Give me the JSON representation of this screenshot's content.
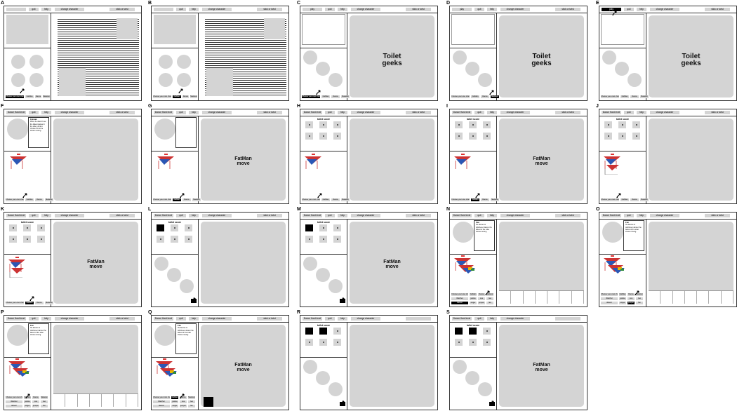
{
  "labels": {
    "quit": "quit",
    "help": "help",
    "change_character": "change character",
    "stick_or_twist": "stick or twist",
    "play": "play",
    "dance_hard_level": "Dance Hard level",
    "toilet_score": "toilet score",
    "toilet_geeks": "Toilet\ngeeks",
    "fatman_move": "FatMan\nmove",
    "tall_bubble_title": "Fatman",
    "tall_bubble_body": "When he doesn't see the fattest dancer in the toilet, click to choose him to be shown moving.",
    "short_bubble_title": "Fan",
    "short_bubble_body": "He dances to whichever dancer the fattest of the toilet shows moving.",
    "sbtn_choose": "Choose your own character",
    "sbtn_fatman": "FatMan",
    "sbtn_dance": "Dance",
    "sbtn_skeleton": "Skeleton",
    "sbtn_watcher": "Watcher",
    "sbtn_justice": "justice",
    "sbtn_one": "one",
    "sbtn_two": "two",
    "sbtn_three": "three",
    "sbtn_dancer": "dancer",
    "sbtn_singer": "singer",
    "sbtn_jumper": "jumper",
    "sbtn_fan": "fan"
  },
  "panels": [
    {
      "id": "A",
      "top": [
        "",
        "quit",
        "help",
        "change character",
        "stick or twist"
      ],
      "layout": "text"
    },
    {
      "id": "B",
      "top": [
        "",
        "quit",
        "help",
        "change character",
        "stick or twist"
      ],
      "layout": "text"
    },
    {
      "id": "C",
      "top": [
        "play",
        "quit",
        "help",
        "change character",
        "stick or twist"
      ],
      "layout": "geeks"
    },
    {
      "id": "D",
      "top": [
        "play",
        "quit",
        "help",
        "change character",
        "stick or twist"
      ],
      "layout": "geeks"
    },
    {
      "id": "E",
      "top": [
        "play",
        "quit",
        "help",
        "change character",
        "stick or twist"
      ],
      "layout": "geeks"
    },
    {
      "id": "F",
      "top": [
        "Dance Hard level",
        "quit",
        "help",
        "change character",
        "stick or twist"
      ],
      "layout": "bubble"
    },
    {
      "id": "G",
      "top": [
        "Dance Hard level",
        "quit",
        "help",
        "change character",
        "stick or twist"
      ],
      "layout": "circle-fatman"
    },
    {
      "id": "H",
      "top": [
        "Dance Hard level",
        "quit",
        "help",
        "change character",
        "stick or twist"
      ],
      "layout": "score"
    },
    {
      "id": "I",
      "top": [
        "Dance Hard level",
        "quit",
        "help",
        "change character",
        "stick or twist"
      ],
      "layout": "score-fatman"
    },
    {
      "id": "J",
      "top": [
        "Dance Hard level",
        "quit",
        "help",
        "change character",
        "stick or twist"
      ],
      "layout": "score-stack"
    },
    {
      "id": "K",
      "top": [
        "Dance Hard level",
        "quit",
        "help",
        "change character",
        "stick or twist"
      ],
      "layout": "score-stack-fatman"
    },
    {
      "id": "L",
      "top": [
        "Dance Hard level",
        "quit",
        "help",
        "change character",
        "stick or twist"
      ],
      "layout": "score-circles"
    },
    {
      "id": "M",
      "top": [
        "Dance Hard level",
        "quit",
        "help",
        "change character",
        "stick or twist"
      ],
      "layout": "score-circles-fatman"
    },
    {
      "id": "N",
      "top": [
        "Dance Hard level",
        "quit",
        "help",
        "change character",
        "stick or twist"
      ],
      "layout": "fan"
    },
    {
      "id": "O",
      "top": [
        "Dance Hard level",
        "quit",
        "help",
        "change character",
        "stick or twist"
      ],
      "layout": "fan-short"
    },
    {
      "id": "P",
      "top": [
        "Dance Hard level",
        "quit",
        "help",
        "change character",
        "stick or twist"
      ],
      "layout": "fan"
    },
    {
      "id": "Q",
      "top": [
        "Dance Hard level",
        "quit",
        "help",
        "change character",
        "stick or twist"
      ],
      "layout": "fan-fatman"
    },
    {
      "id": "R",
      "top": [
        "Dance Hard level",
        "quit",
        "help",
        "change character",
        ""
      ],
      "layout": "score-circles-2"
    },
    {
      "id": "S",
      "top": [
        "Dance Hard level",
        "quit",
        "help",
        "change character",
        ""
      ],
      "layout": "score-circles-2-fatman"
    }
  ]
}
